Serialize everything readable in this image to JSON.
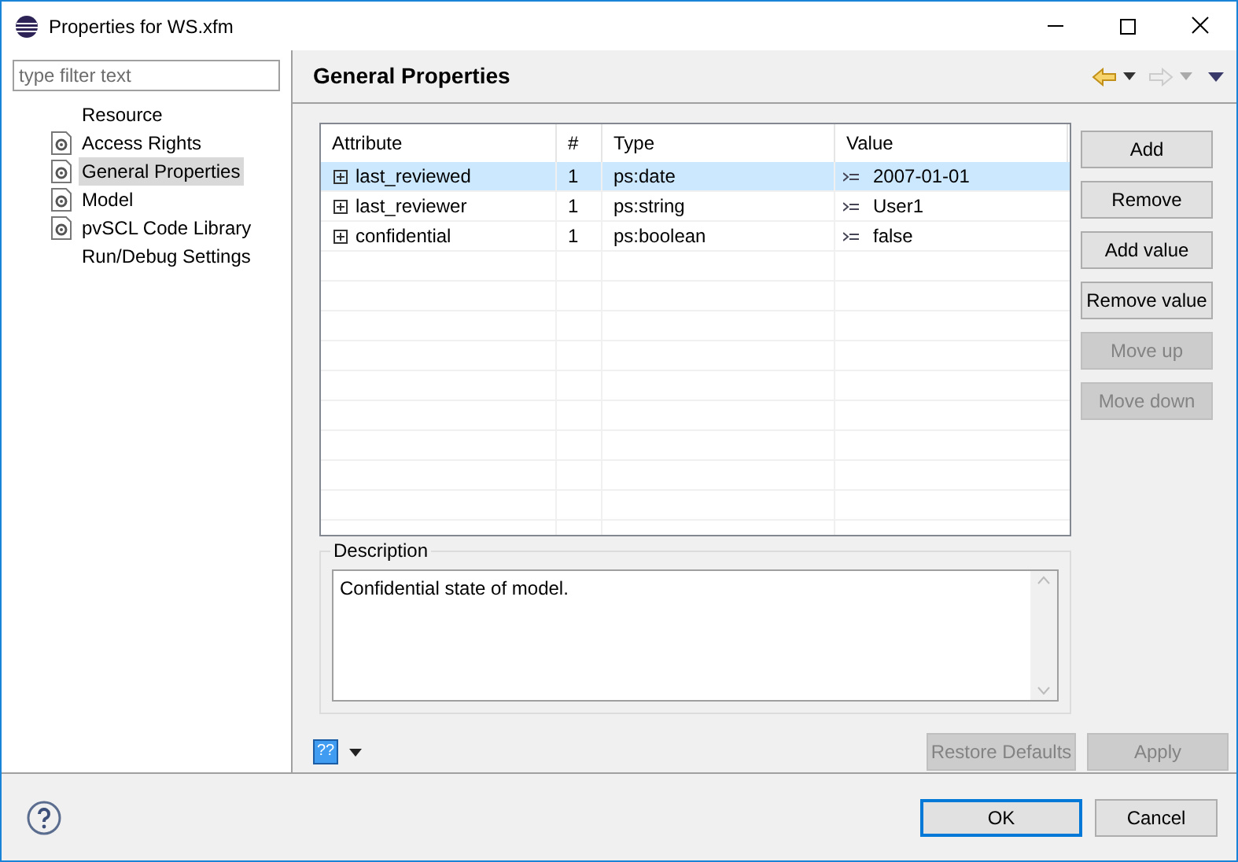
{
  "window": {
    "title": "Properties for WS.xfm"
  },
  "filter": {
    "placeholder": "type filter text"
  },
  "tree": [
    {
      "label": "Resource",
      "has_icon": false,
      "selected": false
    },
    {
      "label": "Access Rights",
      "has_icon": true,
      "selected": false
    },
    {
      "label": "General Properties",
      "has_icon": true,
      "selected": true
    },
    {
      "label": "Model",
      "has_icon": true,
      "selected": false
    },
    {
      "label": "pvSCL Code Library",
      "has_icon": true,
      "selected": false
    },
    {
      "label": "Run/Debug Settings",
      "has_icon": false,
      "selected": false
    }
  ],
  "page": {
    "title": "General Properties"
  },
  "table": {
    "columns": [
      "Attribute",
      "#",
      "Type",
      "Value"
    ],
    "rows": [
      {
        "attribute": "last_reviewed",
        "count": "1",
        "type": "ps:date",
        "value": "2007-01-01",
        "selected": true
      },
      {
        "attribute": "last_reviewer",
        "count": "1",
        "type": "ps:string",
        "value": "User1",
        "selected": false
      },
      {
        "attribute": "confidential",
        "count": "1",
        "type": "ps:boolean",
        "value": "false",
        "selected": false
      }
    ]
  },
  "side_buttons": [
    {
      "label": "Add",
      "disabled": false
    },
    {
      "label": "Remove",
      "disabled": false
    },
    {
      "label": "Add value",
      "disabled": false
    },
    {
      "label": "Remove value",
      "disabled": false
    },
    {
      "label": "Move up",
      "disabled": true
    },
    {
      "label": "Move down",
      "disabled": true
    }
  ],
  "description": {
    "label": "Description",
    "text": "Confidential state of model."
  },
  "help_badge": "??",
  "page_buttons": [
    {
      "label": "Restore Defaults",
      "disabled": true
    },
    {
      "label": "Apply",
      "disabled": true
    }
  ],
  "dialog_buttons": [
    {
      "label": "OK",
      "default": true
    },
    {
      "label": "Cancel",
      "default": false
    }
  ]
}
